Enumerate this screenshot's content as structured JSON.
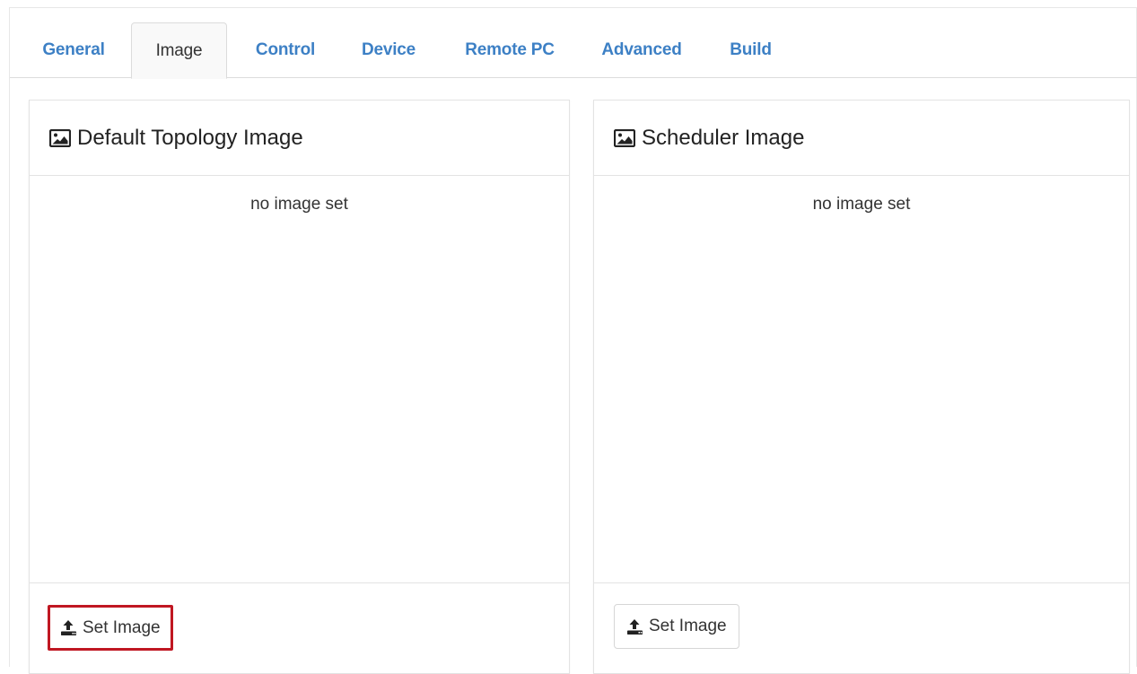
{
  "tabs": [
    {
      "label": "General",
      "active": false
    },
    {
      "label": "Image",
      "active": true
    },
    {
      "label": "Control",
      "active": false
    },
    {
      "label": "Device",
      "active": false
    },
    {
      "label": "Remote PC",
      "active": false
    },
    {
      "label": "Advanced",
      "active": false
    },
    {
      "label": "Build",
      "active": false
    }
  ],
  "panels": {
    "default_topology": {
      "title": "Default Topology Image",
      "title_icon": "image-icon",
      "status": "no image set",
      "button_label": "Set Image",
      "button_icon": "upload-icon",
      "button_highlighted": true
    },
    "scheduler": {
      "title": "Scheduler Image",
      "title_icon": "image-icon",
      "status": "no image set",
      "button_label": "Set Image",
      "button_icon": "upload-icon",
      "button_highlighted": false
    }
  },
  "colors": {
    "tab_link": "#3d80c5",
    "highlight_border": "#c01722"
  }
}
